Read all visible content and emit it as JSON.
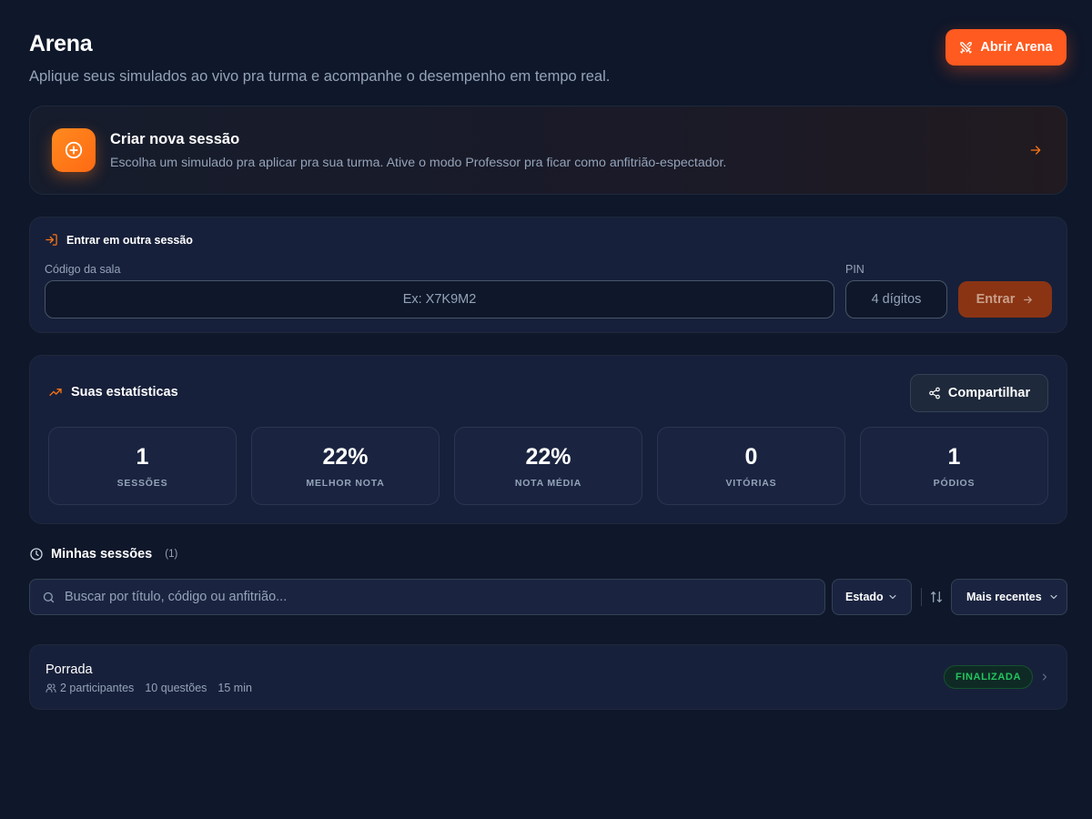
{
  "header": {
    "title": "Arena",
    "subtitle": "Aplique seus simulados ao vivo pra turma e acompanhe o desempenho em tempo real.",
    "open_arena_label": "Abrir Arena"
  },
  "create_session": {
    "title": "Criar nova sessão",
    "description": "Escolha um simulado pra aplicar pra sua turma. Ative o modo Professor pra ficar como anfitrião-espectador."
  },
  "join_session": {
    "title": "Entrar em outra sessão",
    "code_label": "Código da sala",
    "code_placeholder": "Ex: X7K9M2",
    "pin_label": "PIN",
    "pin_placeholder": "4 dígitos",
    "enter_label": "Entrar"
  },
  "stats": {
    "title": "Suas estatísticas",
    "share_label": "Compartilhar",
    "tiles": [
      {
        "value": "1",
        "label": "SESSÕES"
      },
      {
        "value": "22%",
        "label": "MELHOR NOTA"
      },
      {
        "value": "22%",
        "label": "NOTA MÉDIA"
      },
      {
        "value": "0",
        "label": "VITÓRIAS"
      },
      {
        "value": "1",
        "label": "PÓDIOS"
      }
    ]
  },
  "sessions": {
    "title": "Minhas sessões",
    "count": "(1)",
    "search_placeholder": "Buscar por título, código ou anfitrião...",
    "state_filter": "Estado",
    "sort": "Mais recentes",
    "items": [
      {
        "title": "Porrada",
        "participants": "2 participantes",
        "questions": "10 questões",
        "duration": "15 min",
        "status": "FINALIZADA"
      }
    ]
  },
  "colors": {
    "background": "#0f172a",
    "accent": "#ff5a1f",
    "status_finalized": "#22c55e"
  },
  "icons": {
    "open_arena": "swords-icon",
    "create": "plus-circle-icon",
    "join": "log-in-icon",
    "stats": "trending-up-icon",
    "share": "share-icon",
    "sessions": "clock-icon",
    "search": "search-icon",
    "sort": "sort-arrows-icon"
  }
}
